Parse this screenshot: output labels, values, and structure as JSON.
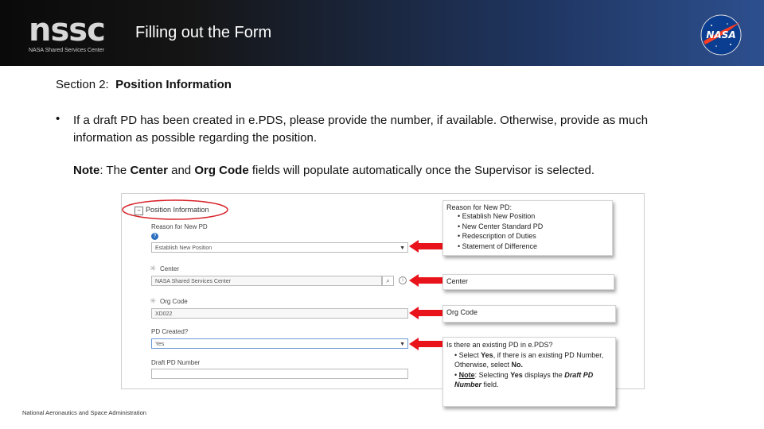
{
  "header": {
    "logo": "nssc",
    "logo_sub": "NASA Shared Services Center",
    "title": "Filling out the Form",
    "nasa_logo": "NASA"
  },
  "section": {
    "prefix": "Section 2:",
    "name": "Position Information"
  },
  "bullet": "If a draft PD has been created in e.PDS, please provide the number, if available. Otherwise, provide as much information as possible regarding the position.",
  "note": {
    "label": "Note",
    "p1": ": The ",
    "center": "Center",
    "p2": " and ",
    "org": "Org Code",
    "p3": " fields will populate automatically once the Supervisor is selected."
  },
  "form": {
    "section_title": "Position Information",
    "reason_label": "Reason for New PD",
    "reason_value": "Establish New Position",
    "center_label": "Center",
    "center_value": "NASA Shared Services Center",
    "org_label": "Org Code",
    "org_value": "XD022",
    "pd_created_label": "PD Created?",
    "pd_created_value": "Yes",
    "draft_label": "Draft PD Number",
    "draft_value": ""
  },
  "callouts": {
    "reason": {
      "title": "Reason for New PD:",
      "items": [
        "Establish New Position",
        "New Center Standard PD",
        "Redescription of Duties",
        "Statement of Difference"
      ]
    },
    "center": "Center",
    "org": "Org Code",
    "pd": {
      "title": "Is there an existing PD in e.PDS?",
      "s1": "Select ",
      "s1b": "Yes",
      "s1c": ", if there is an existing PD Number, Otherwise, select ",
      "s1d": "No.",
      "n1": "Note",
      "n2": ": Selecting ",
      "n3": "Yes",
      "n4": " displays the ",
      "n5": "Draft PD Number",
      "n6": " field."
    }
  },
  "colors": {
    "arrow": "#e8131b",
    "circle": "#d8232a",
    "link_blue": "#2a6ebd"
  },
  "footer": "National Aeronautics and Space Administration"
}
